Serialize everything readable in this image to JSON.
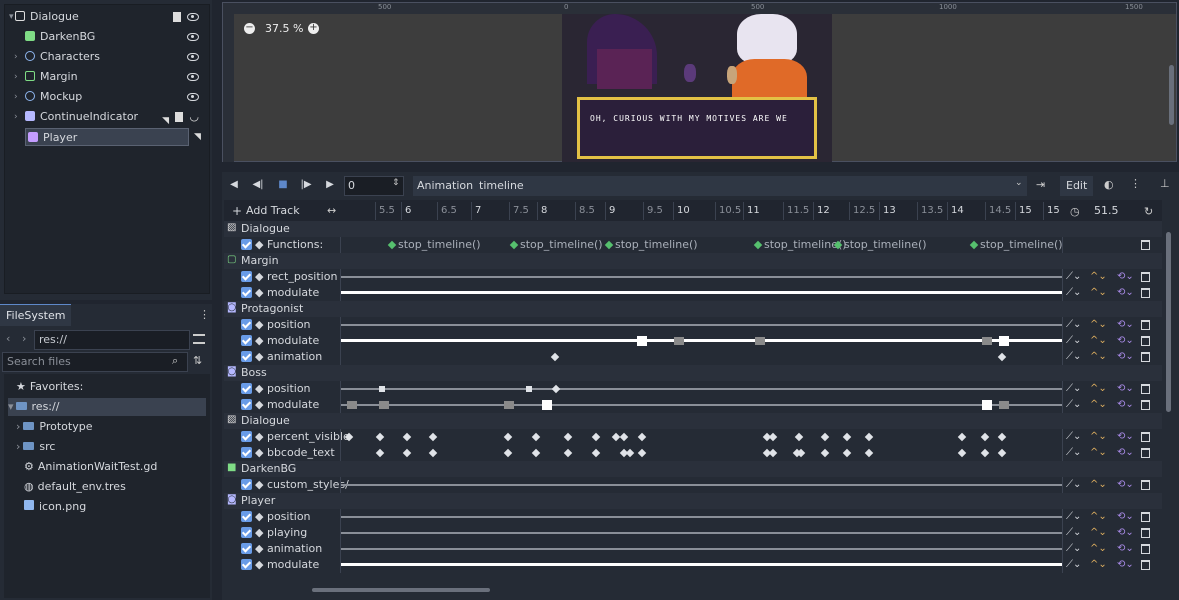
{
  "scene_tree": {
    "root": "Dialogue",
    "children": [
      {
        "label": "DarkenBG",
        "color": "#7fdc86"
      },
      {
        "label": "Characters",
        "color": "#8fb7ef"
      },
      {
        "label": "Margin",
        "color": "#7fdc86"
      },
      {
        "label": "Mockup",
        "color": "#8fb7ef"
      },
      {
        "label": "ContinueIndicator",
        "color": "#b5b8ff"
      },
      {
        "label": "Player",
        "color": "#c49dff"
      }
    ]
  },
  "filesystem": {
    "tab_label": "FileSystem",
    "path": "res://",
    "search_placeholder": "Search files",
    "favorites_label": "Favorites:",
    "root_label": "res://",
    "items": [
      "Prototype",
      "src",
      "AnimationWaitTest.gd",
      "default_env.tres",
      "icon.png"
    ]
  },
  "viewport": {
    "zoom_label": "37.5 %",
    "ruler_labels": [
      "500",
      "0",
      "500",
      "1000",
      "1500"
    ],
    "dialog_text": "Oh, curious with my motives are we"
  },
  "animation_toolbar": {
    "frame_value": "0",
    "animation_button": "Animation",
    "animation_name": "timeline",
    "edit_label": "Edit",
    "add_track_label": "Add Track",
    "length_value": "51.5"
  },
  "timeline_ticks": [
    "5.5",
    "6",
    "6.5",
    "7",
    "7.5",
    "8",
    "8.5",
    "9",
    "9.5",
    "10",
    "10.5",
    "11",
    "11.5",
    "12",
    "12.5",
    "13",
    "13.5",
    "14",
    "14.5",
    "15",
    "15"
  ],
  "function_keys": [
    "stop_timeline()",
    "stop_timeline()",
    "stop_timeline()",
    "stop_timeline()",
    "stop_timeline()",
    "stop_timeline()"
  ],
  "tracks": [
    {
      "group": "Dialogue"
    },
    {
      "prop": "Functions:"
    },
    {
      "group": "Margin"
    },
    {
      "prop": "rect_position"
    },
    {
      "prop": "modulate"
    },
    {
      "group": "Protagonist"
    },
    {
      "prop": "position"
    },
    {
      "prop": "modulate"
    },
    {
      "prop": "animation"
    },
    {
      "group": "Boss"
    },
    {
      "prop": "position"
    },
    {
      "prop": "modulate"
    },
    {
      "group": "Dialogue"
    },
    {
      "prop": "percent_visible"
    },
    {
      "prop": "bbcode_text"
    },
    {
      "group": "DarkenBG"
    },
    {
      "prop": "custom_styles/"
    },
    {
      "group": "Player"
    },
    {
      "prop": "position"
    },
    {
      "prop": "playing"
    },
    {
      "prop": "animation"
    },
    {
      "prop": "modulate"
    }
  ]
}
